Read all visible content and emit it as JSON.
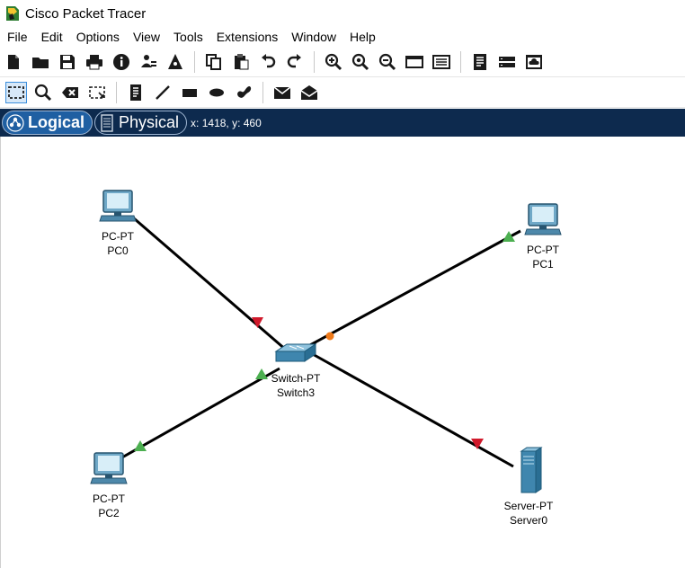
{
  "window": {
    "title": "Cisco Packet Tracer"
  },
  "menu": [
    "File",
    "Edit",
    "Options",
    "View",
    "Tools",
    "Extensions",
    "Window",
    "Help"
  ],
  "mode": {
    "logical_label": "Logical",
    "physical_label": "Physical",
    "coords": "x: 1418, y: 460"
  },
  "devices": {
    "pc0": {
      "type": "PC-PT",
      "name": "PC0"
    },
    "pc1": {
      "type": "PC-PT",
      "name": "PC1"
    },
    "pc2": {
      "type": "PC-PT",
      "name": "PC2"
    },
    "switch3": {
      "type": "Switch-PT",
      "name": "Switch3"
    },
    "server0": {
      "type": "Server-PT",
      "name": "Server0"
    }
  },
  "colors": {
    "link": "#000000",
    "status_up": "#4caf50",
    "status_down": "#d0192b",
    "status_amber": "#f07a1a",
    "mode_bar": "#0d2a4e"
  }
}
